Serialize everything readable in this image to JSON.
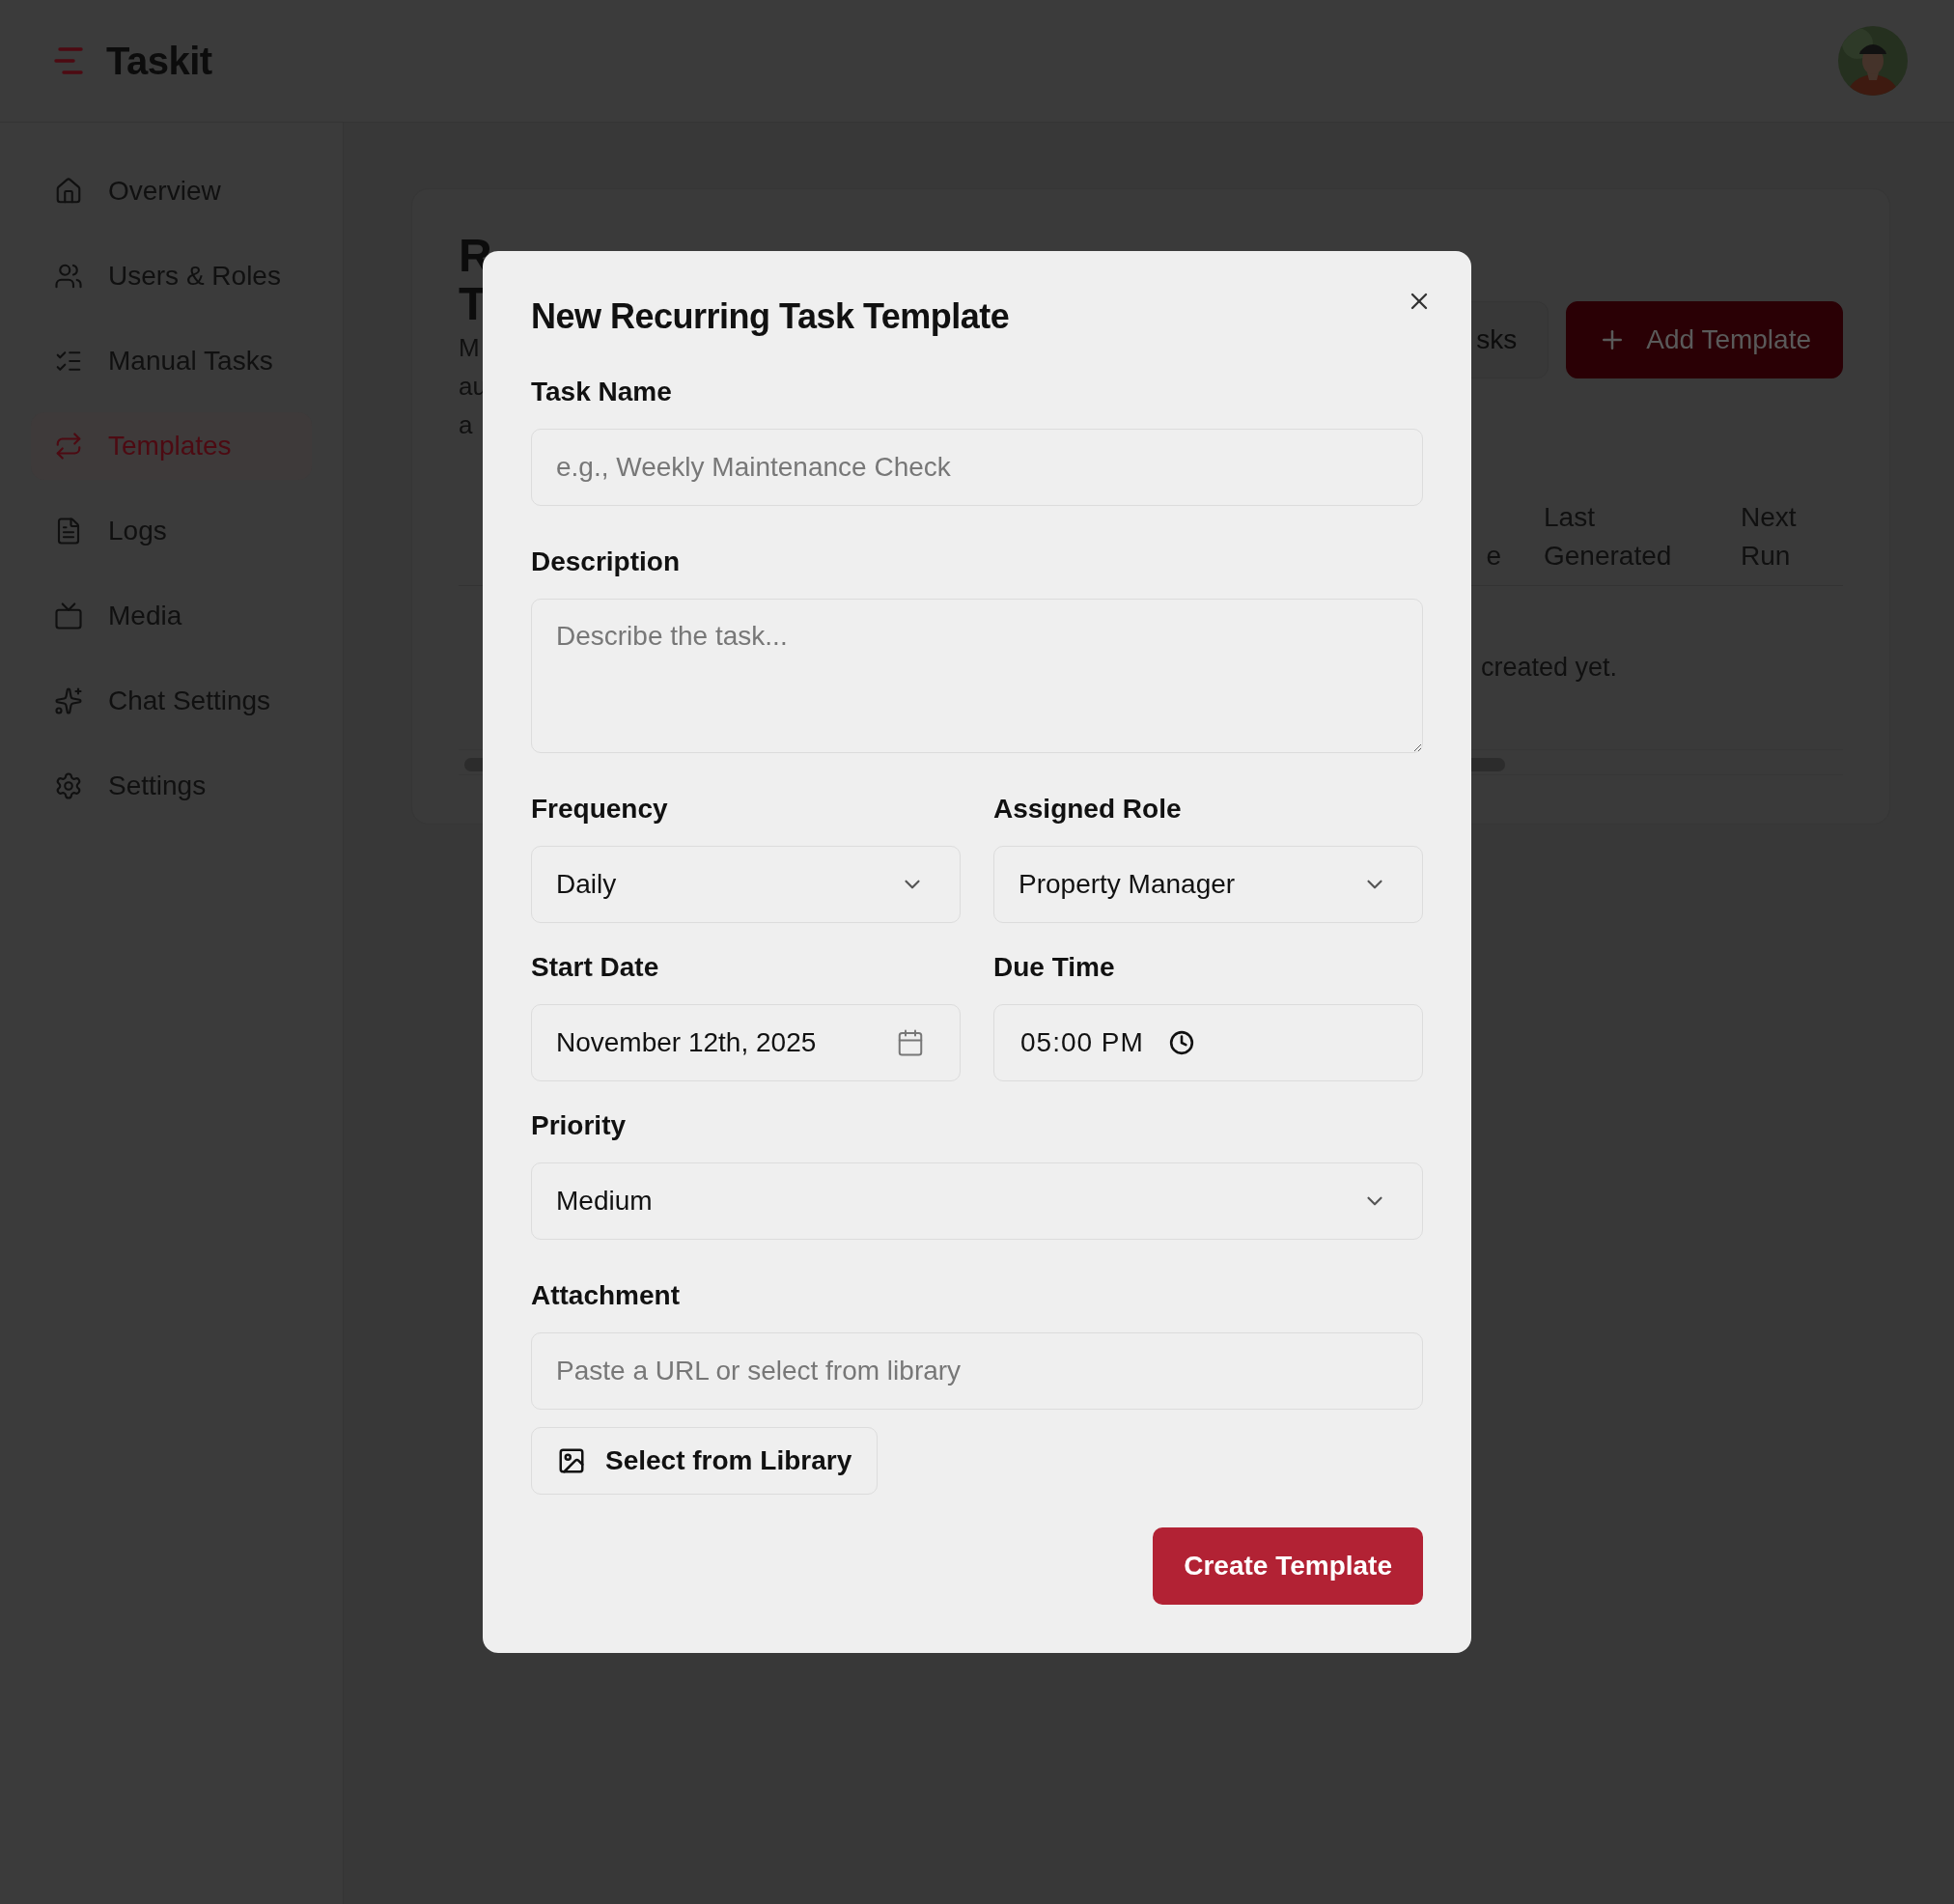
{
  "app": {
    "name": "Taskit"
  },
  "sidebar": {
    "items": [
      {
        "label": "Overview",
        "selected": false
      },
      {
        "label": "Users & Roles",
        "selected": false
      },
      {
        "label": "Manual Tasks",
        "selected": false
      },
      {
        "label": "Templates",
        "selected": true
      },
      {
        "label": "Logs",
        "selected": false
      },
      {
        "label": "Media",
        "selected": false
      },
      {
        "label": "Chat Settings",
        "selected": false
      },
      {
        "label": "Settings",
        "selected": false
      }
    ]
  },
  "page": {
    "title_lines": [
      "R",
      "T"
    ],
    "description_lines": [
      "M",
      "au",
      "a"
    ],
    "buttons": [
      {
        "label": "sks",
        "kind": "secondary"
      },
      {
        "label": "Add Template",
        "kind": "primary"
      }
    ],
    "table": {
      "columns": [
        "e",
        "Last Generated",
        "Next Run"
      ],
      "empty_message": "created yet."
    }
  },
  "dialog": {
    "title": "New Recurring Task Template",
    "rows": [
      {
        "fields": [
          {
            "kind": "text",
            "label": "Task Name",
            "placeholder": "e.g., Weekly Maintenance Check"
          }
        ]
      },
      {
        "fields": [
          {
            "kind": "textarea",
            "label": "Description",
            "placeholder": "Describe the task..."
          }
        ]
      },
      {
        "fields": [
          {
            "kind": "select",
            "label": "Frequency",
            "value": "Daily"
          },
          {
            "kind": "select",
            "label": "Assigned Role",
            "value": "Property Manager"
          }
        ]
      },
      {
        "fields": [
          {
            "kind": "date",
            "label": "Start Date",
            "value": "November 12th, 2025"
          },
          {
            "kind": "time",
            "label": "Due Time",
            "value": "05:00 PM"
          }
        ]
      },
      {
        "fields": [
          {
            "kind": "select",
            "label": "Priority",
            "value": "Medium"
          }
        ]
      },
      {
        "fields": [
          {
            "kind": "text",
            "label": "Attachment",
            "placeholder": "Paste a URL or select from library"
          }
        ]
      }
    ],
    "library_button": "Select from Library",
    "submit": "Create Template"
  }
}
